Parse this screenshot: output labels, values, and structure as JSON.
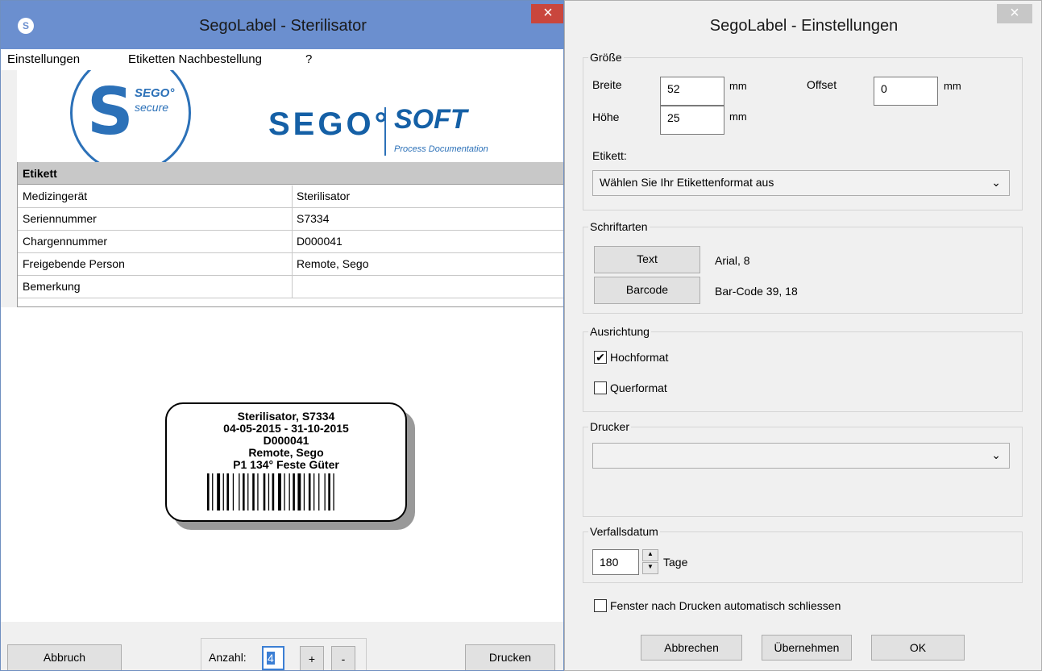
{
  "left_window": {
    "title": "SegoLabel - Sterilisator",
    "close": "×",
    "menu": [
      "Einstellungen",
      "Etiketten Nachbestellung",
      "?"
    ],
    "logo": {
      "sego_small": "SEGO°",
      "secure_small": "secure",
      "sego_big": "SEGO°",
      "soft": "SOFT",
      "soft_sub": "Process Documentation"
    },
    "table": {
      "header": "Etikett",
      "rows": [
        {
          "label": "Medizingerät",
          "value": "Sterilisator"
        },
        {
          "label": "Seriennummer",
          "value": "S7334"
        },
        {
          "label": "Chargennummer",
          "value": "D000041"
        },
        {
          "label": "Freigebende Person",
          "value": "Remote, Sego"
        },
        {
          "label": "Bemerkung",
          "value": ""
        }
      ]
    },
    "label_preview": {
      "lines": [
        "Sterilisator, S7334",
        "04-05-2015 - 31-10-2015",
        "D000041",
        "Remote, Sego",
        "P1 134° Feste Güter"
      ]
    },
    "bottom": {
      "abbruch": "Abbruch",
      "anzahl_label": "Anzahl:",
      "anzahl_value": "4",
      "plus": "+",
      "minus": "-",
      "drucken": "Drucken"
    }
  },
  "right_window": {
    "title": "SegoLabel - Einstellungen",
    "close": "×",
    "groesse": {
      "legend": "Größe",
      "breite_label": "Breite",
      "breite_value": "52",
      "hoehe_label": "Höhe",
      "hoehe_value": "25",
      "offset_label": "Offset",
      "offset_value": "0",
      "unit": "mm",
      "etikett_label": "Etikett:",
      "etikett_value": "Wählen Sie Ihr Etikettenformat aus"
    },
    "schriftarten": {
      "legend": "Schriftarten",
      "text_button": "Text",
      "text_font": "Arial, 8",
      "barcode_button": "Barcode",
      "barcode_font": "Bar-Code 39, 18"
    },
    "ausrichtung": {
      "legend": "Ausrichtung",
      "hochformat": "Hochformat",
      "hochformat_checked": true,
      "querformat": "Querformat",
      "querformat_checked": false
    },
    "drucker": {
      "legend": "Drucker",
      "value": ""
    },
    "verfallsdatum": {
      "legend": "Verfallsdatum",
      "value": "180",
      "unit": "Tage"
    },
    "auto_close": {
      "label": "Fenster nach Drucken automatisch schliessen",
      "checked": false
    },
    "buttons": {
      "abbrechen": "Abbrechen",
      "uebernehmen": "Übernehmen",
      "ok": "OK"
    }
  }
}
